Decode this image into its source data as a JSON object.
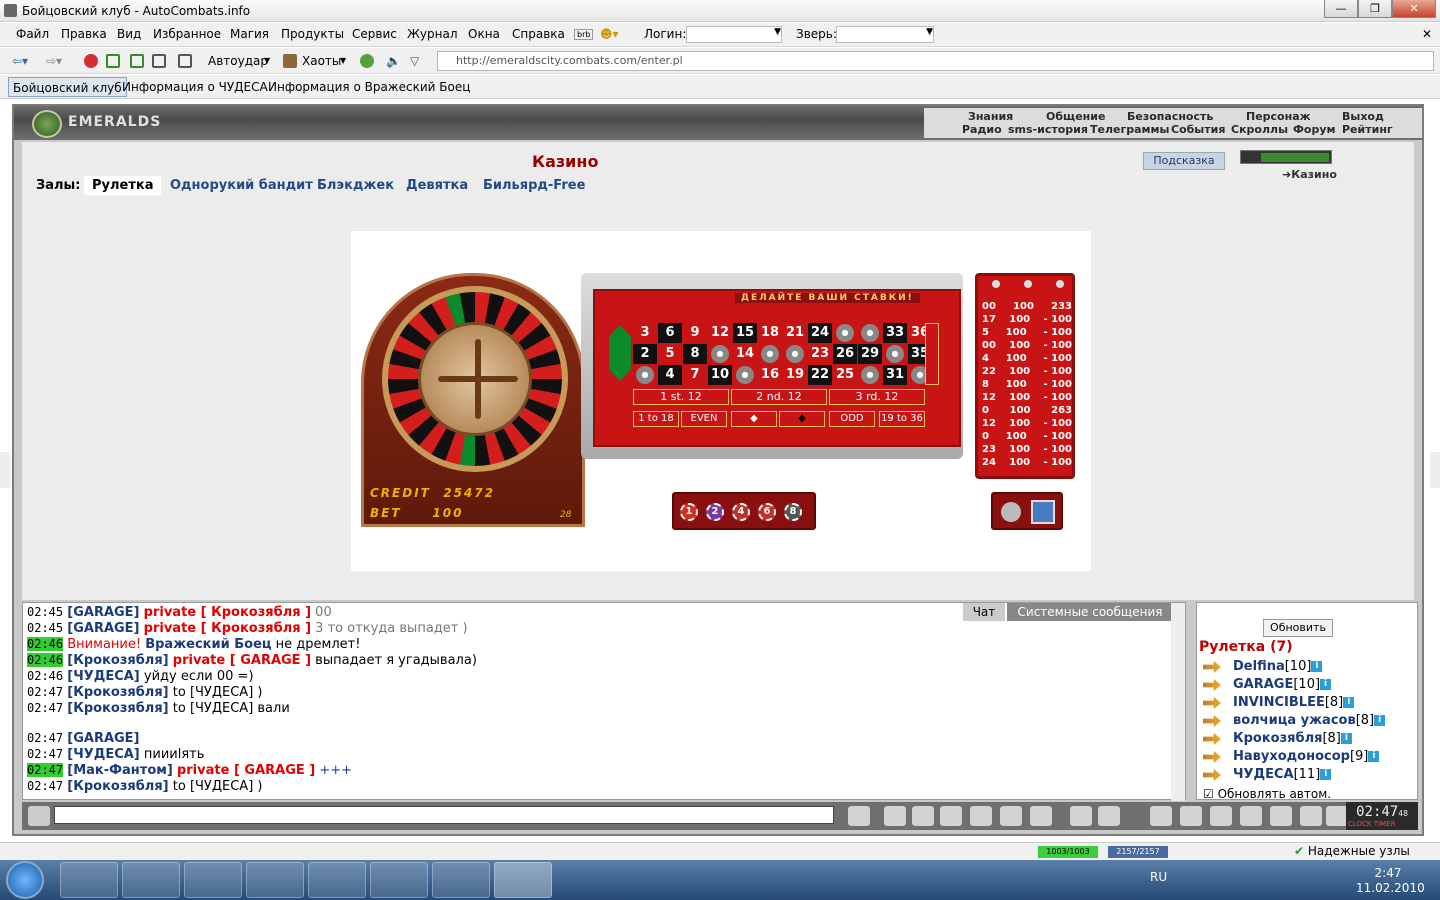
{
  "window": {
    "title": "Бойцовский клуб - AutoCombats.info"
  },
  "menu": [
    "Файл",
    "Правка",
    "Вид",
    "Избранное",
    "Магия",
    "Продукты",
    "Сервис",
    "Журнал",
    "Окна",
    "Справка"
  ],
  "login": {
    "login_label": "Логин:",
    "pet_label": "Зверь:",
    "brb": "brb"
  },
  "toolbar": {
    "autoudar": "Автоудар",
    "haoty": "Хаоты",
    "address": "http://emeraldscity.combats.com/enter.pl"
  },
  "tabs": [
    "Бойцовский клуб",
    "Информация о ЧУДЕСА",
    "Информация о Вражеский Боец"
  ],
  "game": {
    "logo": "EMERALDS",
    "nav1": [
      "Знания",
      "Общение",
      "Безопасность",
      "Персонаж",
      "Выход"
    ],
    "nav2": [
      "Радио",
      "sms-история",
      "Телеграммы",
      "События",
      "Скроллы",
      "Форум",
      "Рейтинг"
    ],
    "title": "Казино",
    "hint": "Подсказка",
    "location": "Казино",
    "halls_label": "Залы:",
    "halls": [
      "Рулетка",
      "Однорукий бандит",
      "Блэкджек",
      "Девятка",
      "Бильярд-Free"
    ]
  },
  "roulette": {
    "header": "ДЕЛАЙТЕ ВАШИ СТАВКИ!",
    "credit_label": "CREDIT",
    "credit": "25472",
    "bet_label": "BET",
    "bet": "100",
    "bet_small": "28",
    "rows": [
      [
        "3",
        "6",
        "9",
        "12",
        "15",
        "18",
        "21",
        "24",
        "●",
        "●",
        "33",
        "36"
      ],
      [
        "2",
        "5",
        "8",
        "●",
        "14",
        "●",
        "●",
        "23",
        "26",
        "29",
        "●",
        "35"
      ],
      [
        "●",
        "4",
        "7",
        "10",
        "●",
        "16",
        "19",
        "22",
        "25",
        "●",
        "31",
        "●"
      ]
    ],
    "dozens": [
      "1 st. 12",
      "2 nd. 12",
      "3 rd. 12"
    ],
    "outside": [
      "1 to 18",
      "EVEN",
      "ODD",
      "19 to 36"
    ],
    "chips": [
      "1",
      "2",
      "4",
      "6",
      "8"
    ],
    "score": [
      [
        "00",
        "100",
        "233"
      ],
      [
        "17",
        "100",
        "- 100"
      ],
      [
        "5",
        "100",
        "- 100"
      ],
      [
        "00",
        "100",
        "- 100"
      ],
      [
        "4",
        "100",
        "- 100"
      ],
      [
        "22",
        "100",
        "- 100"
      ],
      [
        "8",
        "100",
        "- 100"
      ],
      [
        "12",
        "100",
        "- 100"
      ],
      [
        "0",
        "100",
        "263"
      ],
      [
        "12",
        "100",
        "- 100"
      ],
      [
        "0",
        "100",
        "- 100"
      ],
      [
        "23",
        "100",
        "- 100"
      ],
      [
        "24",
        "100",
        "- 100"
      ]
    ]
  },
  "chat": {
    "tab_chat": "Чат",
    "tab_sys": "Системные сообщения",
    "lines": [
      {
        "time": "02:45",
        "who": "[GARAGE]",
        "priv": "private [ Крокозябля ]",
        "text": "00"
      },
      {
        "time": "02:45",
        "who": "[GARAGE]",
        "priv": "private [ Крокозябля ]",
        "text": "3 то откуда выпадет )"
      },
      {
        "time": "02:46",
        "warn": "Внимание!",
        "who": "Вражеский Боец",
        "text": "не дремлет!"
      },
      {
        "time": "02:46",
        "who": "[Крокозябля]",
        "priv": "private [ GARAGE ]",
        "text": "выпадает я угадывала)"
      },
      {
        "time": "02:46",
        "who": "[ЧУДЕСА]",
        "text": "уйду если 00 =)"
      },
      {
        "time": "02:47",
        "who": "[Крокозябля]",
        "text": "to [ЧУДЕСА] )"
      },
      {
        "time": "02:47",
        "who": "[Крокозябля]",
        "text": "to [ЧУДЕСА] вали"
      },
      {
        "time": "02:47",
        "who": "[GARAGE]",
        "text": ""
      },
      {
        "time": "02:47",
        "who": "[ЧУДЕСА]",
        "text": "пиииlять"
      },
      {
        "time": "02:47",
        "who": "[Мак-Фантом]",
        "priv": "private [ GARAGE ]",
        "text": "+++"
      },
      {
        "time": "02:47",
        "who": "[Крокозябля]",
        "text": "to [ЧУДЕСА] )"
      }
    ]
  },
  "users": {
    "refresh": "Обновить",
    "room": "Рулетка (7)",
    "list": [
      {
        "name": "Delfina",
        "lvl": "[10]"
      },
      {
        "name": "GARAGE",
        "lvl": "[10]"
      },
      {
        "name": "INVINCIBLEE",
        "lvl": "[8]"
      },
      {
        "name": "волчица ужасов",
        "lvl": "[8]"
      },
      {
        "name": "Крокозябля",
        "lvl": "[8]"
      },
      {
        "name": "Навуходоносор",
        "lvl": "[9]"
      },
      {
        "name": "ЧУДЕСА",
        "lvl": "[11]"
      }
    ],
    "autorefresh": "Обновлять автом."
  },
  "clock": {
    "time": "02:47",
    "sec": "48",
    "clock_label": "CLOCK",
    "timer_label": "TIMER"
  },
  "status": {
    "s1": "1003/1003",
    "s2": "2157/2157",
    "nodes": "Надежные узлы"
  },
  "taskbar": {
    "lang": "RU",
    "time": "2:47",
    "date": "11.02.2010"
  }
}
